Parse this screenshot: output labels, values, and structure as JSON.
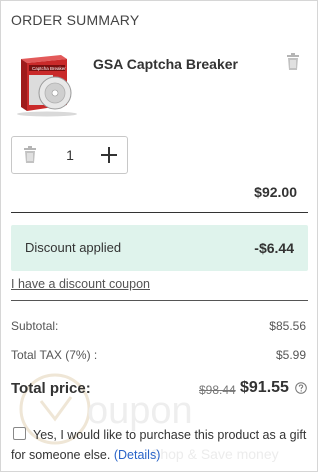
{
  "order_summary": {
    "title": "ORDER SUMMARY",
    "product": {
      "name": "GSA Captcha Breaker",
      "box_label": "Captcha Breaker"
    },
    "quantity": "1",
    "line_price": "$92.00",
    "discount": {
      "label": "Discount applied",
      "amount": "-$6.44"
    },
    "coupon_link": "I have a discount coupon",
    "subtotal": {
      "label": "Subtotal:",
      "value": "$85.56"
    },
    "tax": {
      "label": "Total TAX (7%) :",
      "value": "$5.99"
    },
    "total": {
      "label": "Total price:",
      "old_value": "$98.44",
      "value": "$91.55"
    },
    "gift": {
      "text": "Yes, I would like to purchase this product as a gift for someone else.",
      "details_link": "(Details)"
    },
    "watermark": {
      "word": "oupon",
      "tagline": "Shop & Save money"
    }
  },
  "colors": {
    "discount_bg": "#dff3ec",
    "link_blue": "#2a64c8",
    "border": "#d6d6d6"
  },
  "icons": {
    "remove": "trash-icon",
    "decrease": "trash-icon",
    "increase": "plus-icon",
    "help": "question-circle-icon"
  }
}
